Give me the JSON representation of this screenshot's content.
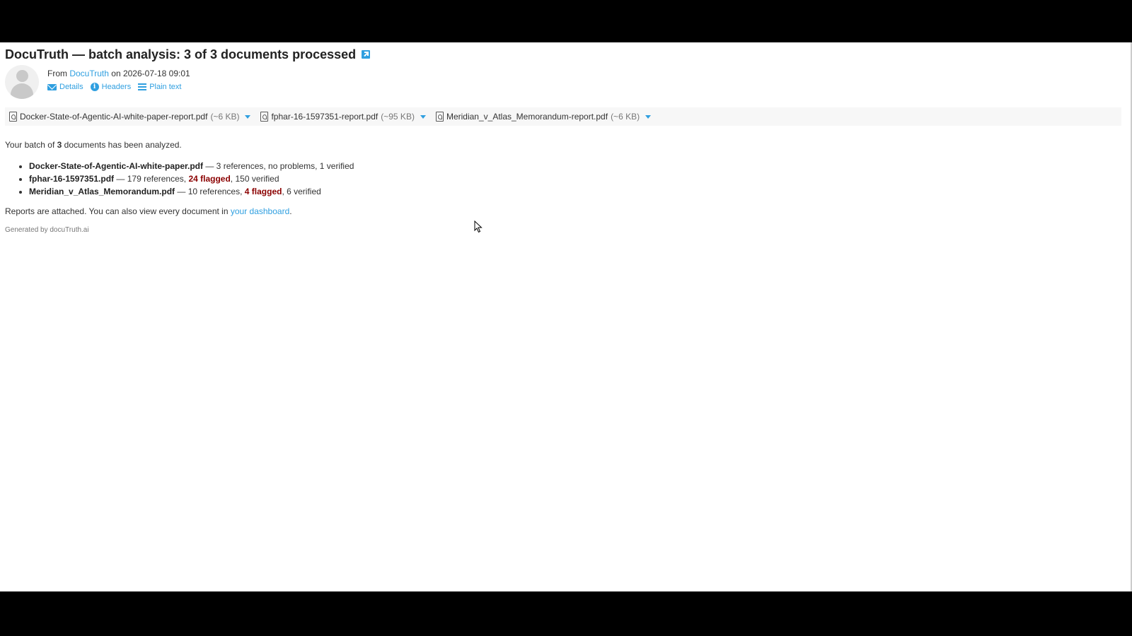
{
  "email": {
    "subject": "DocuTruth — batch analysis: 3 of 3 documents processed",
    "from_prefix": "From",
    "sender": "DocuTruth",
    "on_text": "on 2026-07-18 09:01",
    "actions": {
      "details": "Details",
      "headers": "Headers",
      "plain_text": "Plain text"
    }
  },
  "attachments": [
    {
      "name": "Docker-State-of-Agentic-AI-white-paper-report.pdf",
      "size": "(~6 KB)"
    },
    {
      "name": "fphar-16-1597351-report.pdf",
      "size": "(~95 KB)"
    },
    {
      "name": "Meridian_v_Atlas_Memorandum-report.pdf",
      "size": "(~6 KB)"
    }
  ],
  "body": {
    "intro_pre": "Your batch of ",
    "intro_count": "3",
    "intro_post": " documents has been analyzed.",
    "documents": [
      {
        "name": "Docker-State-of-Agentic-AI-white-paper.pdf",
        "pre": " — 3 references, no problems, 1 verified",
        "flag": "",
        "post": ""
      },
      {
        "name": "fphar-16-1597351.pdf",
        "pre": " — 179 references, ",
        "flag": "24 flagged",
        "post": ", 150 verified"
      },
      {
        "name": "Meridian_v_Atlas_Memorandum.pdf",
        "pre": " — 10 references, ",
        "flag": "4 flagged",
        "post": ", 6 verified"
      }
    ],
    "reports_pre": "Reports are attached. You can also view every document in ",
    "dashboard_link": "your dashboard",
    "reports_post": ".",
    "footer": "Generated by docuTruth.ai"
  },
  "colors": {
    "link": "#2f9fe0",
    "flagged": "#8b0000"
  }
}
